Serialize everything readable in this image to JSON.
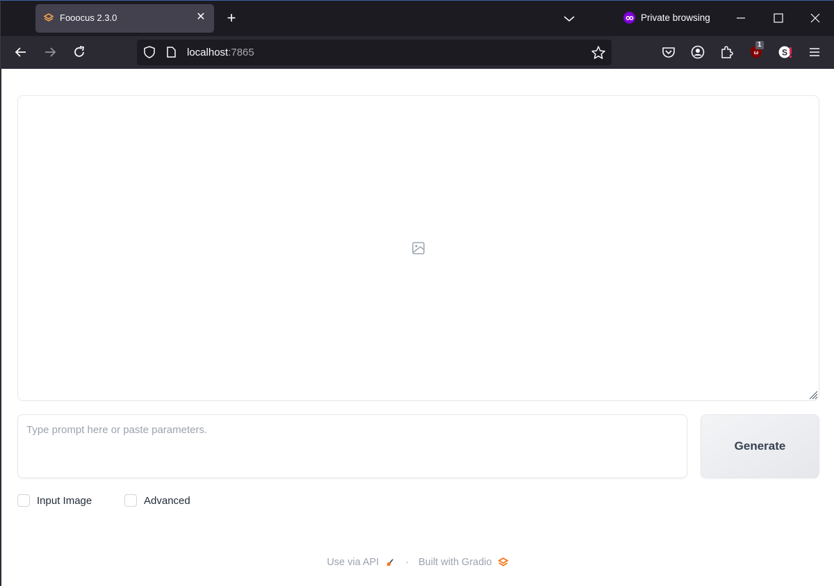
{
  "browser": {
    "tab": {
      "title": "Fooocus 2.3.0",
      "icon": "gradio-logo-icon"
    },
    "private_label": "Private browsing",
    "url": {
      "host": "localhost",
      "port": ":7865"
    },
    "extension_badge": "1",
    "icons": {
      "back": "arrow-left-icon",
      "forward": "arrow-right-icon",
      "reload": "reload-icon",
      "shield": "shield-icon",
      "page": "page-icon",
      "bookmark": "star-icon",
      "pocket": "pocket-icon",
      "account": "account-icon",
      "extensions": "puzzle-icon",
      "ublock": "ublock-icon",
      "extension2": "s-extension-icon",
      "menu": "hamburger-icon"
    }
  },
  "app": {
    "gallery": {
      "placeholder_icon": "image-icon"
    },
    "prompt": {
      "placeholder": "Type prompt here or paste parameters.",
      "value": ""
    },
    "generate_label": "Generate",
    "checkboxes": [
      {
        "label": "Input Image",
        "checked": false
      },
      {
        "label": "Advanced",
        "checked": false
      }
    ]
  },
  "footer": {
    "api_label": "Use via API",
    "separator": "·",
    "built_label": "Built with Gradio"
  },
  "colors": {
    "accent": "#f97316",
    "private": "#8000d7"
  }
}
